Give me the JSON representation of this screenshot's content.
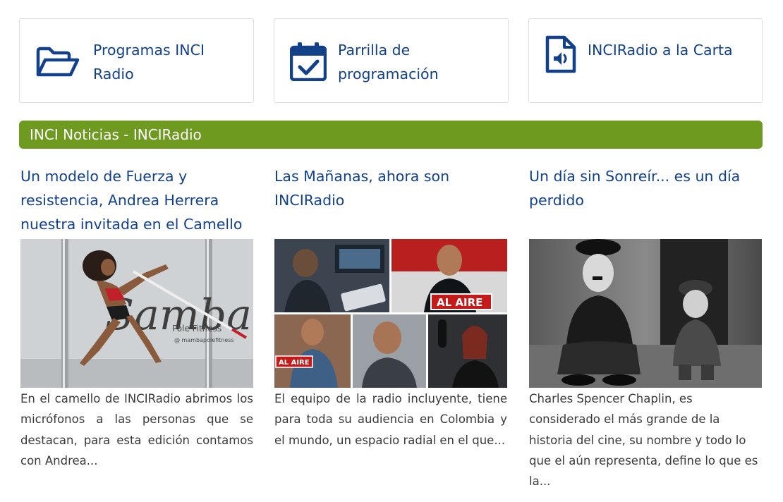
{
  "quick_links": [
    {
      "label": "Programas INCI Radio",
      "icon": "folder-open-icon"
    },
    {
      "label": "Parrilla de programación",
      "icon": "calendar-check-icon"
    },
    {
      "label": "INCIRadio a la Carta",
      "icon": "audio-file-icon"
    }
  ],
  "section": {
    "title": "INCI Noticias - INCIRadio"
  },
  "news": [
    {
      "title": "Un modelo de Fuerza y resistencia, Andrea Herrera nuestra invitada en el Camello",
      "excerpt": "En el camello de INCIRadio abrimos los micrófonos a las personas que se destacan, para esta edición contamos con Andrea...",
      "image_text": {
        "logo": "Samba",
        "sub": "Pole Fitness",
        "handle": "@ mambapolefitness"
      }
    },
    {
      "title": "Las Mañanas, ahora son INCIRadio",
      "excerpt": "El equipo de la radio incluyente, tiene para toda su audiencia en Colombia y el mundo, un espacio radial en el que...",
      "image_text": {
        "sign1": "AL AIRE",
        "sign2": "AL AIRE"
      }
    },
    {
      "title": "Un día sin Sonreír... es un día perdido",
      "excerpt": "Charles Spencer Chaplin, es considerado el más grande de la historia del cine, su nombre y todo lo que el aún representa, define lo que es la..."
    }
  ],
  "colors": {
    "link_blue": "#12418a",
    "banner_green": "#6d9a1f",
    "body_text": "#3a3a3a"
  }
}
